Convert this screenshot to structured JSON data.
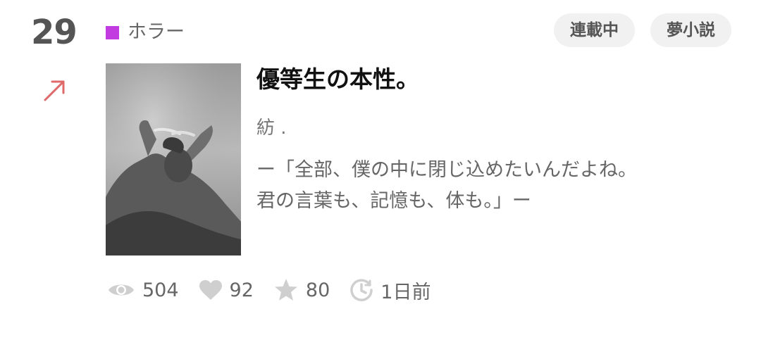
{
  "item": {
    "rank": "29",
    "trend_icon": "trend-up-arrow-icon",
    "genre": {
      "label": "ホラー",
      "color": "#c13be0"
    },
    "badges": [
      "連載中",
      "夢小説"
    ],
    "title": "優等生の本性。",
    "author": "紡 .",
    "synopsis": [
      "ー「全部、僕の中に閉じ込めたいんだよね。",
      "君の言葉も、記憶も、体も。」ー"
    ],
    "stats": {
      "views": "504",
      "likes": "92",
      "stars": "80",
      "updated": "1日前"
    },
    "colors": {
      "trend_arrow": "#e06a6a",
      "icon_gray": "#cfcfcf",
      "badge_bg": "#f1f1f1"
    }
  }
}
